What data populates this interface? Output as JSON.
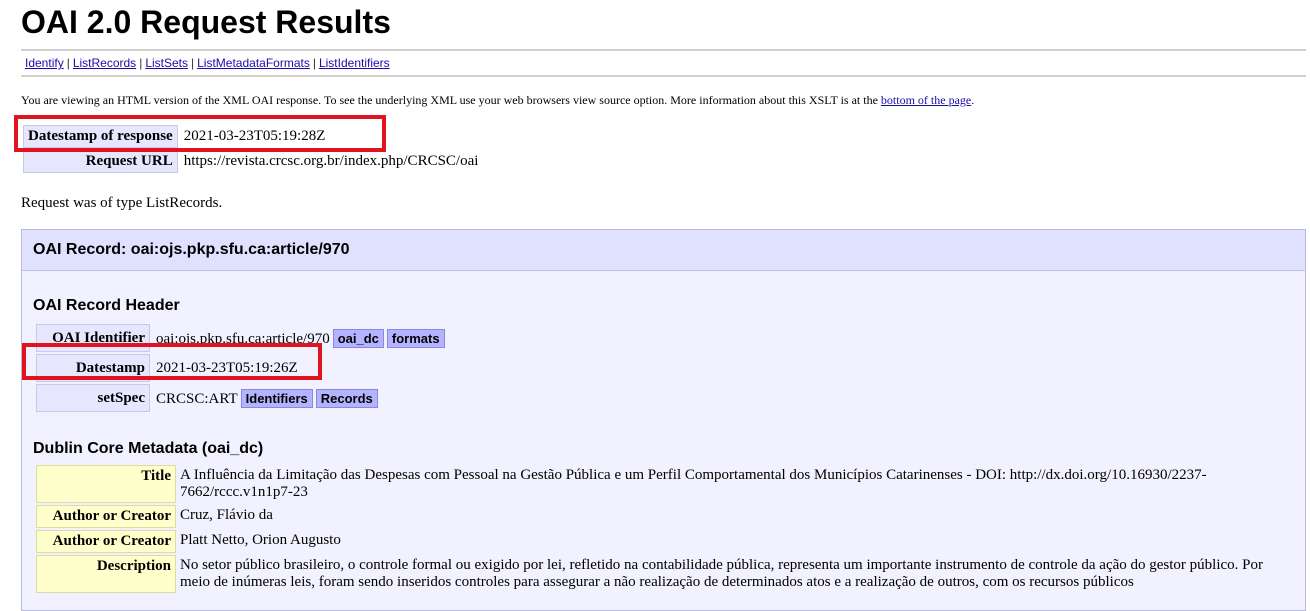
{
  "page": {
    "title": "OAI 2.0 Request Results"
  },
  "nav": {
    "items": [
      "Identify",
      "ListRecords",
      "ListSets",
      "ListMetadataFormats",
      "ListIdentifiers"
    ],
    "separator": "|"
  },
  "intro": {
    "text": "You are viewing an HTML version of the XML OAI response. To see the underlying XML use your web browsers view source option. More information about this XSLT is at the ",
    "link": "bottom of the page",
    "end": "."
  },
  "response": {
    "datestamp_label": "Datestamp of response",
    "datestamp_value": "2021-03-23T05:19:28Z",
    "url_label": "Request URL",
    "url_value": "https://revista.crcsc.org.br/index.php/CRCSC/oai"
  },
  "request_type": "Request was of type ListRecords.",
  "record": {
    "title": "OAI Record: oai:ojs.pkp.sfu.ca:article/970",
    "header_title": "OAI Record Header",
    "identifier_label": "OAI Identifier",
    "identifier_value": "oai:ojs.pkp.sfu.ca:article/970",
    "identifier_tags": [
      "oai_dc",
      "formats"
    ],
    "datestamp_label": "Datestamp",
    "datestamp_value": "2021-03-23T05:19:26Z",
    "setspec_label": "setSpec",
    "setspec_value": "CRCSC:ART",
    "setspec_tags": [
      "Identifiers",
      "Records"
    ],
    "dc_title": "Dublin Core Metadata (oai_dc)",
    "dc": [
      {
        "label": "Title",
        "value": "A Influência da Limitação das Despesas com Pessoal na Gestão Pública e um Perfil Comportamental dos Municípios Catarinenses - DOI: http://dx.doi.org/10.16930/2237-7662/rccc.v1n1p7-23"
      },
      {
        "label": "Author or Creator",
        "value": "Cruz, Flávio da"
      },
      {
        "label": "Author or Creator",
        "value": "Platt Netto, Orion Augusto"
      },
      {
        "label": "Description",
        "value": "No setor público brasileiro, o controle formal ou exigido por lei, refletido na contabilidade pública, representa um importante instrumento de controle da ação do gestor público. Por meio de inúmeras leis, foram sendo inseridos controles para assegurar a não realização de determinados atos e a realização de outros, com os recursos públicos"
      }
    ]
  },
  "colors": {
    "highlight": "#e0141e",
    "label_blue": "#e6e6ff",
    "label_yellow": "#ffffcc",
    "tag": "#b3b3ff"
  }
}
